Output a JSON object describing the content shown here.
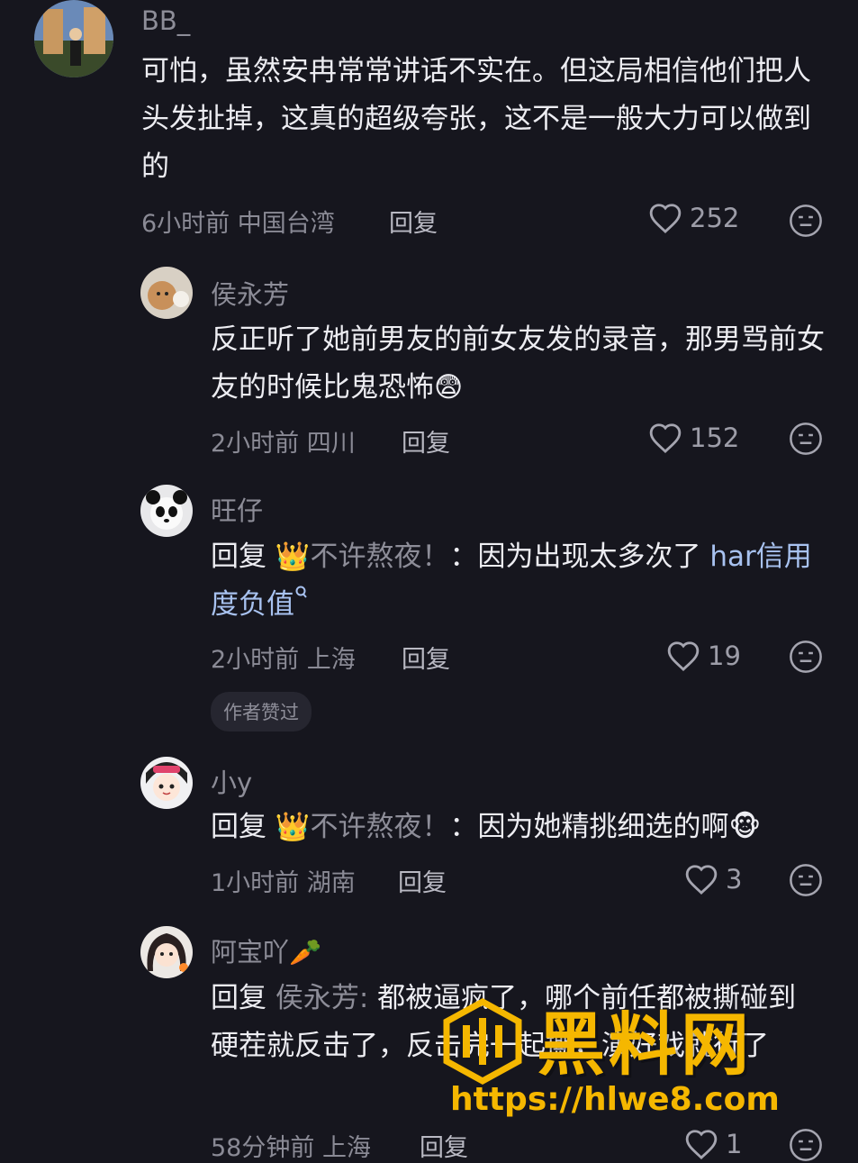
{
  "comments": [
    {
      "user": "BB_",
      "text": "可怕，虽然安冉常常讲话不实在。但这局相信他们把人头发扯掉，这真的超级夸张，这不是一般大力可以做到的",
      "time": "6小时前",
      "location": "中国台湾",
      "reply_label": "回复",
      "likes": "252"
    },
    {
      "user": "侯永芳",
      "text": "反正听了她前男友的前女友发的录音，那男骂前女友的时候比鬼恐怖😨",
      "time": "2小时前",
      "location": "四川",
      "reply_label": "回复",
      "likes": "152"
    },
    {
      "user": "旺仔",
      "reply_prefix": "回复",
      "crown": "👑",
      "reply_to": "不许熬夜！",
      "text": "：因为出现太多次了",
      "link_text": "har信用度负值",
      "time": "2小时前",
      "location": "上海",
      "reply_label": "回复",
      "likes": "19",
      "badge": "作者赞过"
    },
    {
      "user": "小y",
      "reply_prefix": "回复",
      "crown": "👑",
      "reply_to": "不许熬夜！",
      "text": "：因为她精挑细选的啊🐵",
      "time": "1小时前",
      "location": "湖南",
      "reply_label": "回复",
      "likes": "3"
    },
    {
      "user": "阿宝吖🥕",
      "reply_prefix": "回复",
      "reply_to": "侯永芳:",
      "text": "都被逼疯了，哪个前任都被撕碰到硬茬就反击了，反击完一起撕，演好戏就行了",
      "time": "58分钟前",
      "location": "上海",
      "reply_label": "回复",
      "likes": "1"
    }
  ],
  "watermark": {
    "title": "黑料网",
    "url": "https://hlwe8.com"
  },
  "icons": {
    "like": "heart-outline-icon",
    "dislike": "meh-face-icon"
  },
  "colors": {
    "background": "#16161e",
    "watermark": "#f5b700",
    "link": "#a8c2f0"
  }
}
